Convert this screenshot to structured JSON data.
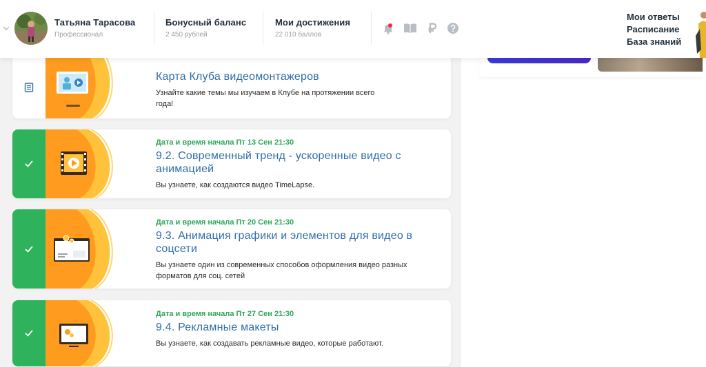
{
  "header": {
    "user": {
      "name": "Татьяна Тарасова",
      "role": "Профессионал"
    },
    "bonus": {
      "title": "Бонусный баланс",
      "value": "2 450 рублей"
    },
    "achievements": {
      "title": "Мои достижения",
      "value": "22 010 баллов"
    },
    "icons": [
      "bell-icon",
      "book-icon",
      "ruble-icon",
      "help-icon"
    ],
    "menu": [
      "Мои ответы",
      "Расписание",
      "База знаний"
    ]
  },
  "cards": [
    {
      "date": "",
      "title": "Карта Клуба видеомонтажеров",
      "desc": "Узнайте какие темы мы изучаем в Клубе на протяжении всего года!",
      "status": "doc"
    },
    {
      "date": "Дата и время начала Пт 13 Сен 21:30",
      "title": "9.2. Современный тренд - ускоренные видео с анимацией",
      "desc": "Вы узнаете, как создаются видео TimeLapse.",
      "status": "done"
    },
    {
      "date": "Дата и время начала Пт 20 Сен 21:30",
      "title": "9.3. Анимация графики и элементов для видео в соцсети",
      "desc": "Вы узнаете один из современных способов оформления видео разных форматов для соц. сетей",
      "status": "done"
    },
    {
      "date": "Дата и время начала Пт 27 Сен 21:30",
      "title": "9.4. Рекламные макеты",
      "desc": "Вы узнаете, как создавать рекламные видео, которые работают.",
      "status": "done"
    }
  ],
  "colors": {
    "accent_green": "#2fb25c",
    "title_blue": "#2f6ea8",
    "orange": "#ff9a1f",
    "yellow": "#ffc93c"
  }
}
